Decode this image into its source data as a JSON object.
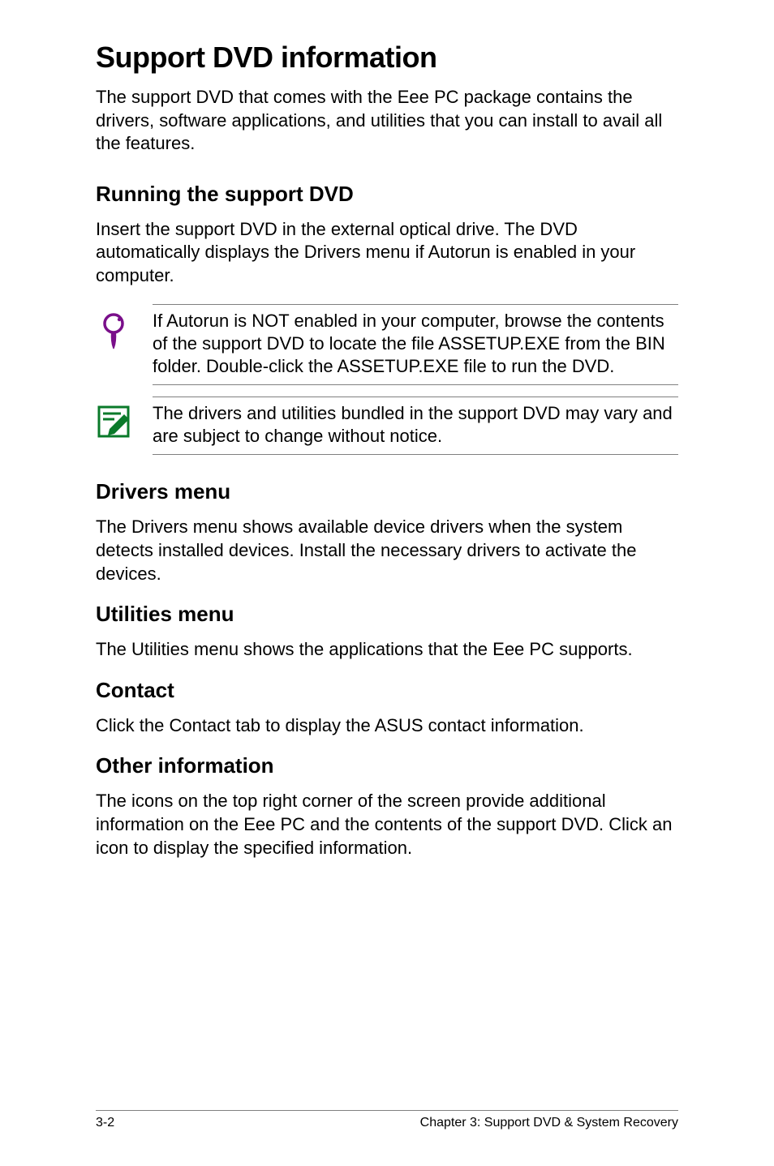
{
  "title": "Support DVD information",
  "intro": "The support DVD that comes with the Eee PC package contains the drivers, software applications, and utilities that you can install to avail all the features.",
  "sections": {
    "running": {
      "heading": "Running the support DVD",
      "para": "Insert the support DVD in the external optical drive. The DVD automatically displays the Drivers menu if Autorun is enabled in your computer.",
      "callout1": "If Autorun is NOT enabled in your computer, browse the contents of the support DVD to locate the file ASSETUP.EXE from the BIN folder. Double-click the ASSETUP.EXE file to run the DVD.",
      "callout2": "The drivers and utilities bundled in the support DVD may vary and are subject to change without notice."
    },
    "drivers": {
      "heading": "Drivers menu",
      "para": "The Drivers menu shows available device drivers when the system detects installed devices. Install the necessary drivers to activate the devices."
    },
    "utilities": {
      "heading": "Utilities menu",
      "para": "The Utilities menu shows the applications that the Eee PC supports."
    },
    "contact": {
      "heading": "Contact",
      "para": "Click the Contact tab to display the ASUS contact information."
    },
    "other": {
      "heading": "Other information",
      "para": "The icons on the top right corner of the screen provide additional information on the Eee PC and the contents of the support DVD. Click an icon to display the specified information."
    }
  },
  "footer": {
    "page": "3-2",
    "chapter": "Chapter 3: Support DVD & System Recovery"
  }
}
